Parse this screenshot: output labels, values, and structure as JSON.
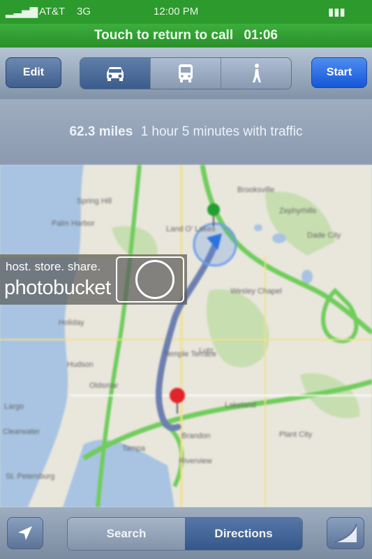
{
  "status_bar": {
    "carrier": "AT&T",
    "network": "3G",
    "time": "12:00 PM",
    "battery": "100%"
  },
  "call_bar": {
    "label": "Touch to return to call",
    "duration": "01:06"
  },
  "toolbar": {
    "edit_label": "Edit",
    "modes": [
      {
        "icon": "car-icon",
        "selected": true
      },
      {
        "icon": "bus-icon",
        "selected": false
      },
      {
        "icon": "walk-icon",
        "selected": false
      }
    ],
    "start_label": "Start"
  },
  "route": {
    "distance": "62.3 miles",
    "duration_text": "1 hour 5 minutes with traffic"
  },
  "map": {
    "places": [
      "Spring Hill",
      "Brooksville",
      "Land O' Lakes",
      "Wesley Chapel",
      "Zephyrhills",
      "Lutz",
      "Temple Terrace",
      "Lakeland",
      "Brandon",
      "Tampa",
      "Clearwater",
      "Largo",
      "Palm Harbor",
      "Riverview",
      "Plant City",
      "Dade City",
      "St. Petersburg",
      "Oldsmar",
      "Holiday",
      "Hudson"
    ],
    "start_pin_color": "#1fa030",
    "end_pin_color": "#e0242a",
    "route_color": "#6d7fb0",
    "location_dot_color": "#2a73e0"
  },
  "watermark": {
    "tagline": "host. store. share.",
    "logo": "photobucket"
  },
  "bottom_bar": {
    "search_label": "Search",
    "directions_label": "Directions",
    "location_icon": "location-arrow-icon",
    "curl_icon": "page-curl-icon"
  }
}
